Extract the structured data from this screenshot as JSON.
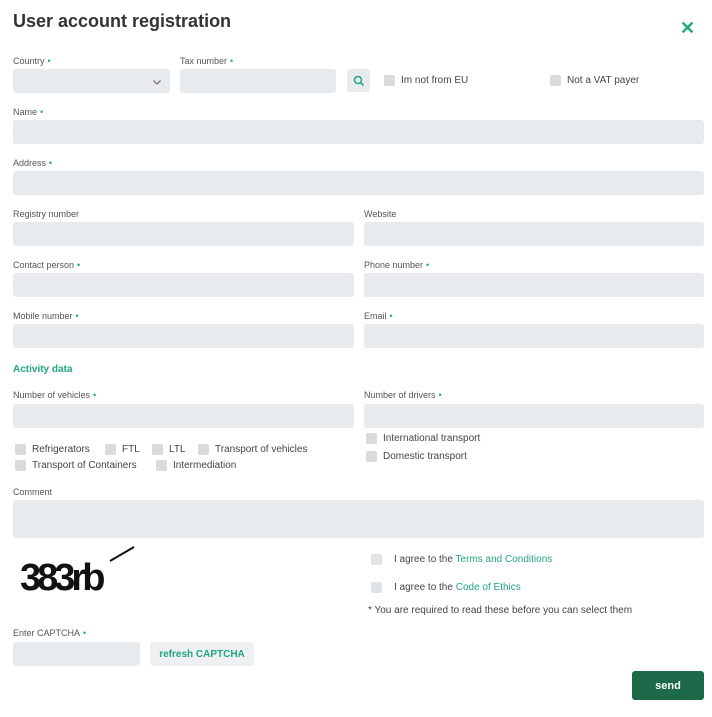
{
  "header": {
    "title": "User account registration",
    "close_icon": "✕"
  },
  "fields": {
    "country": {
      "label": "Country",
      "value": ""
    },
    "tax_number": {
      "label": "Tax number",
      "value": ""
    },
    "not_from_eu": "Im not from EU",
    "not_vat_payer": "Not a VAT payer",
    "name": {
      "label": "Name",
      "value": ""
    },
    "address": {
      "label": "Address",
      "value": ""
    },
    "registry_number": {
      "label": "Registry number",
      "value": ""
    },
    "website": {
      "label": "Website",
      "value": ""
    },
    "contact_person": {
      "label": "Contact person",
      "value": ""
    },
    "phone_number": {
      "label": "Phone number",
      "value": ""
    },
    "mobile_number": {
      "label": "Mobile number",
      "value": ""
    },
    "email": {
      "label": "Email",
      "value": ""
    }
  },
  "activity": {
    "heading": "Activity data",
    "number_of_vehicles": {
      "label": "Number of vehicles",
      "value": ""
    },
    "number_of_drivers": {
      "label": "Number of drivers",
      "value": ""
    },
    "types": [
      "Refrigerators",
      "FTL",
      "LTL",
      "Transport of vehicles",
      "Transport of Containers",
      "Intermediation"
    ],
    "scope": [
      "International transport",
      "Domestic transport"
    ]
  },
  "comment": {
    "label": "Comment",
    "value": ""
  },
  "captcha": {
    "text": "383rb",
    "label": "Enter CAPTCHA",
    "value": "",
    "refresh_label": "refresh CAPTCHA"
  },
  "agreements": {
    "prefix": "I agree to the",
    "terms_link": "Terms and Conditions",
    "ethics_link": "Code of Ethics",
    "note": "* You are required to read these before you can select them"
  },
  "required_mark": "•",
  "send_label": "send",
  "colors": {
    "accent": "#21a582",
    "send": "#1d6a4b",
    "field_bg": "#e8ebed"
  }
}
